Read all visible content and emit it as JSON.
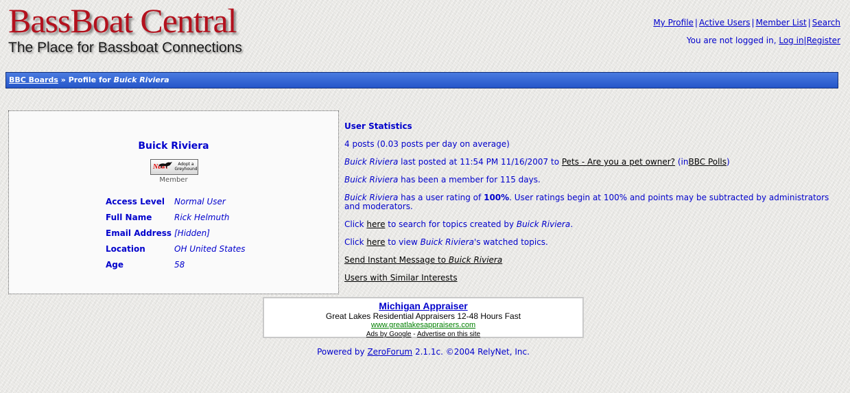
{
  "logo": {
    "line1": "BassBoat Central",
    "line2": "The Place for Bassboat Connections"
  },
  "topnav": {
    "my_profile": "My Profile",
    "active_users": "Active Users",
    "member_list": "Member List",
    "search": "Search"
  },
  "login": {
    "prefix": "You are not logged in,",
    "log_in": "Log in",
    "register": "Register"
  },
  "breadcrumb": {
    "home": "BBC Boards",
    "separator": "»",
    "prefix": "Profile for",
    "user": "Buick Riviera"
  },
  "profile": {
    "name": "Buick Riviera",
    "badge_new": "New!",
    "badge_text": "Adopt a Greyhound",
    "rank": "Member",
    "fields": [
      {
        "label": "Access Level",
        "value": "Normal User"
      },
      {
        "label": "Full Name",
        "value": "Rick Helmuth"
      },
      {
        "label": "Email Address",
        "value": "[Hidden]"
      },
      {
        "label": "Location",
        "value": "OH United States"
      },
      {
        "label": "Age",
        "value": "58"
      }
    ]
  },
  "stats": {
    "title": "User Statistics",
    "posts": "4 posts (0.03 posts per day on average)",
    "user": "Buick Riviera",
    "last_posted_mid": "last posted at 11:54 PM 11/16/2007 to",
    "last_topic": "Pets - Are you a pet owner?",
    "in_prefix": "(in",
    "forum": "BBC Polls",
    "in_suffix": ")",
    "member_for": "has been a member for 115 days.",
    "rating_pre": "has a user rating of",
    "rating": "100%",
    "rating_post": ". User ratings begin at 100% and points may be subtracted by administrators and moderators.",
    "click": "Click",
    "here": "here",
    "search_topics": "to search for topics created by",
    "view_watched_pre": "to view",
    "view_watched_post": "'s watched topics.",
    "send_im": "Send Instant Message to",
    "similar": "Users with Similar Interests",
    "period": "."
  },
  "ad": {
    "title": "Michigan Appraiser",
    "desc": "Great Lakes Residential Appraisers 12-48 Hours Fast",
    "url": "www.greatlakesappraisers.com",
    "ads_by": "Ads by Google",
    "dash": "-",
    "advertise": "Advertise on this site"
  },
  "footer": {
    "prefix": "Powered by",
    "link": "ZeroForum",
    "suffix": "2.1.1c. ©2004 RelyNet, Inc."
  }
}
